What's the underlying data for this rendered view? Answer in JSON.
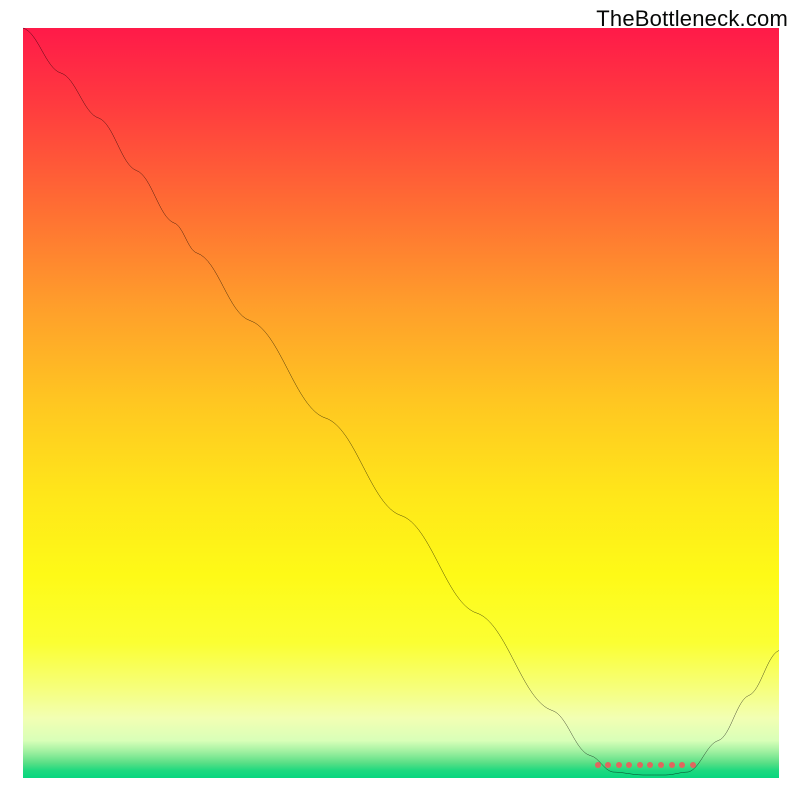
{
  "watermark": "TheBottleneck.com",
  "chart_data": {
    "type": "line",
    "title": "",
    "xlabel": "",
    "ylabel": "",
    "xlim": [
      0,
      100
    ],
    "ylim": [
      0,
      100
    ],
    "grid": false,
    "series": [
      {
        "name": "bottleneck-curve",
        "x": [
          0,
          5,
          10,
          15,
          20,
          23,
          30,
          40,
          50,
          60,
          70,
          75,
          78,
          82,
          85,
          88,
          92,
          96,
          100
        ],
        "values": [
          100,
          94,
          88,
          81,
          74,
          70,
          61,
          48,
          35,
          22,
          9,
          3,
          0.8,
          0.4,
          0.4,
          0.8,
          5,
          11,
          17
        ]
      }
    ],
    "markers": {
      "name": "optimal-range-dots",
      "x": [
        76,
        77.4,
        78.8,
        80.2,
        81.6,
        83,
        84.4,
        85.8,
        87.2,
        88.6
      ],
      "y_fraction_of_height": 0.987
    },
    "background": "vertical gradient red→orange→yellow→pale→green (thin green band at bottom)"
  }
}
